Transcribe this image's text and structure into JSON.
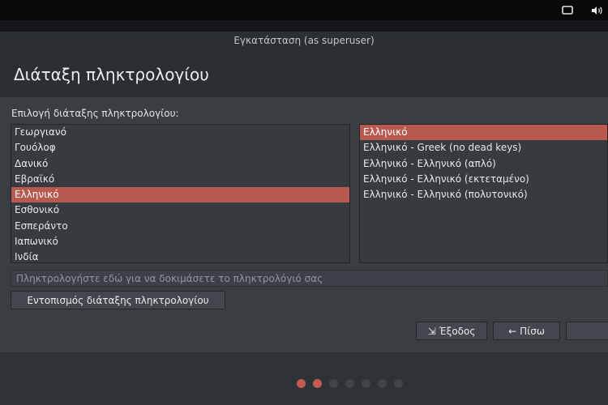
{
  "window": {
    "title": "Εγκατάσταση (as superuser)"
  },
  "page": {
    "heading": "Διάταξη πληκτρολογίου",
    "section_label": "Επιλογή διάταξης πληκτρολογίου:"
  },
  "layouts": {
    "items": [
      "Γεωργιανό",
      "Γουόλοφ",
      "Δανικό",
      "Εβραϊκό",
      "Ελληνικό",
      "Εσθονικό",
      "Εσπεράντο",
      "Ιαπωνικό",
      "Ινδία"
    ],
    "selected": "Ελληνικό"
  },
  "variants": {
    "items": [
      "Ελληνικό",
      "Ελληνικό - Greek (no dead keys)",
      "Ελληνικό - Ελληνικό (απλό)",
      "Ελληνικό - Ελληνικό (εκτεταμένο)",
      "Ελληνικό - Ελληνικό (πολυτονικό)"
    ],
    "selected": "Ελληνικό"
  },
  "test_input": {
    "placeholder": "Πληκτρολογήστε εδώ για να δοκιμάσετε το πληκτρολόγιό σας",
    "value": ""
  },
  "buttons": {
    "detect": "Εντοπισμός διάταξης πληκτρολογίου",
    "quit": "Έξοδος",
    "back": "Πίσω",
    "quit_icon": "exit-icon",
    "back_icon": "arrow-left-icon"
  },
  "progress": {
    "total_steps": 7,
    "current_step": 2
  },
  "colors": {
    "accent": "#b85a4f",
    "background": "#3a3e43",
    "topbar": "#08090a"
  },
  "tray_icons": [
    "screen-icon",
    "volume-icon"
  ]
}
